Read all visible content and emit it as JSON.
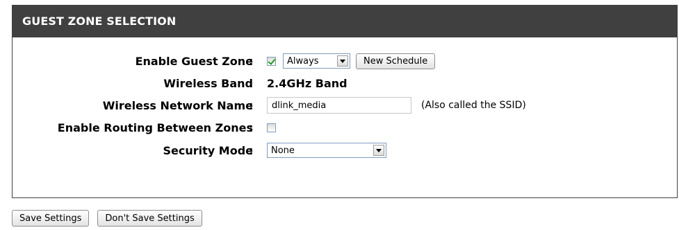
{
  "section": {
    "title": "GUEST ZONE SELECTION"
  },
  "fields": {
    "enable_guest_zone": {
      "label": "Enable Guest Zone",
      "checked": true,
      "schedule_value": "Always",
      "new_schedule_label": "New Schedule"
    },
    "wireless_band": {
      "label": "Wireless Band",
      "value": "2.4GHz Band"
    },
    "wireless_network_name": {
      "label": "Wireless Network Name",
      "value": "dlink_media",
      "note": "(Also called the SSID)"
    },
    "enable_routing": {
      "label": "Enable Routing Between Zones",
      "checked": false
    },
    "security_mode": {
      "label": "Security Mode",
      "value": "None"
    }
  },
  "colon": ":",
  "footer": {
    "save_label": "Save Settings",
    "dont_save_label": "Don't Save Settings"
  },
  "colors": {
    "header_bg": "#404040",
    "header_text": "#ffffff",
    "checkbox_check": "#21a121"
  }
}
